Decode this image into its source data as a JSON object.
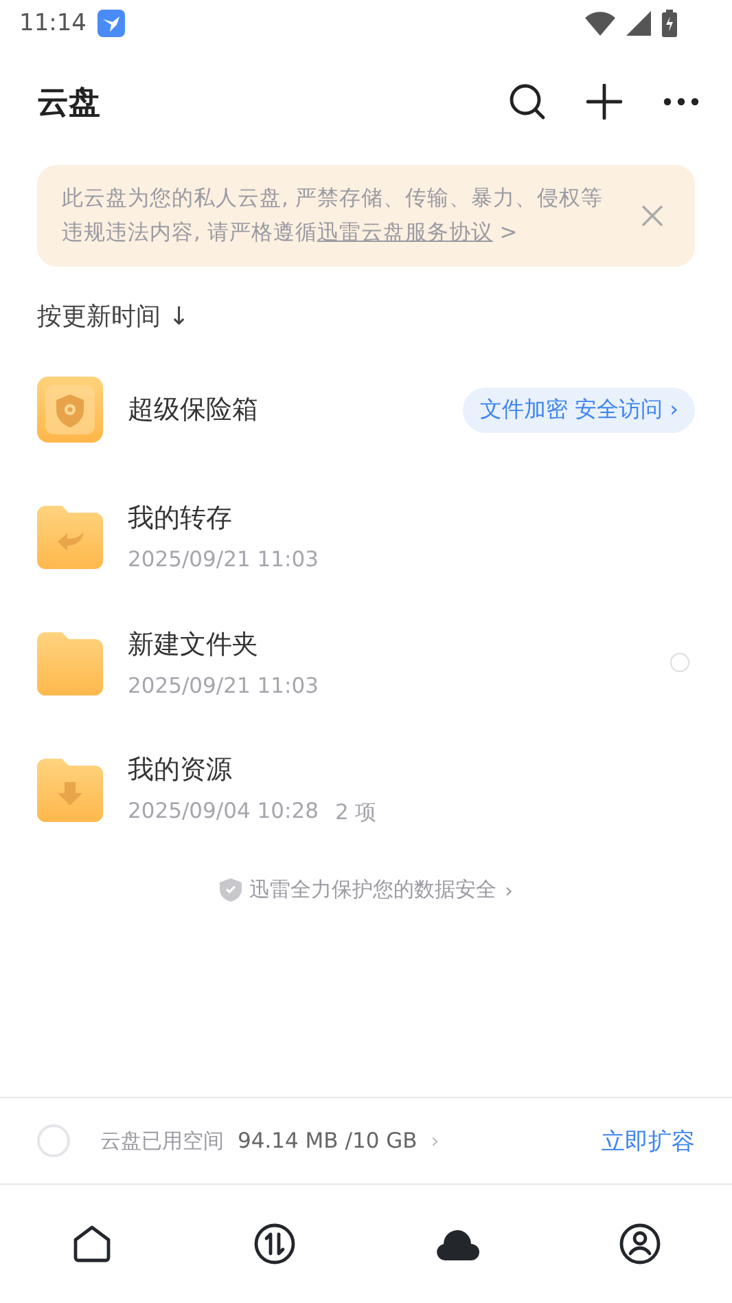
{
  "status_bar": {
    "time": "11:14"
  },
  "header": {
    "title": "云盘"
  },
  "notice": {
    "text": "此云盘为您的私人云盘, 严禁存储、传输、暴力、侵权等违规违法内容, 请严格遵循",
    "link": "迅雷云盘服务协议",
    "tail": " >"
  },
  "sort": {
    "label": "按更新时间 ↓"
  },
  "items": [
    {
      "kind": "vault",
      "name": "超级保险箱",
      "action": "文件加密 安全访问 ›",
      "select_circle": false
    },
    {
      "kind": "transfers",
      "name": "我的转存",
      "meta": "2025/09/21 11:03",
      "select_circle": false
    },
    {
      "kind": "folder",
      "name": "新建文件夹",
      "meta": "2025/09/21 11:03",
      "select_circle": true
    },
    {
      "kind": "downloads",
      "name": "我的资源",
      "meta": "2025/09/04 10:28",
      "count": "2 项",
      "select_circle": false
    }
  ],
  "protect": {
    "text": "迅雷全力保护您的数据安全",
    "chevron": "›"
  },
  "storage": {
    "label": "云盘已用空间",
    "value": "94.14 MB /10 GB",
    "chevron": "›",
    "action": "立即扩容"
  },
  "nav": [
    {
      "kind": "home",
      "selected": false
    },
    {
      "kind": "transfer",
      "selected": false
    },
    {
      "kind": "cloud",
      "selected": true
    },
    {
      "kind": "profile",
      "selected": false
    }
  ]
}
